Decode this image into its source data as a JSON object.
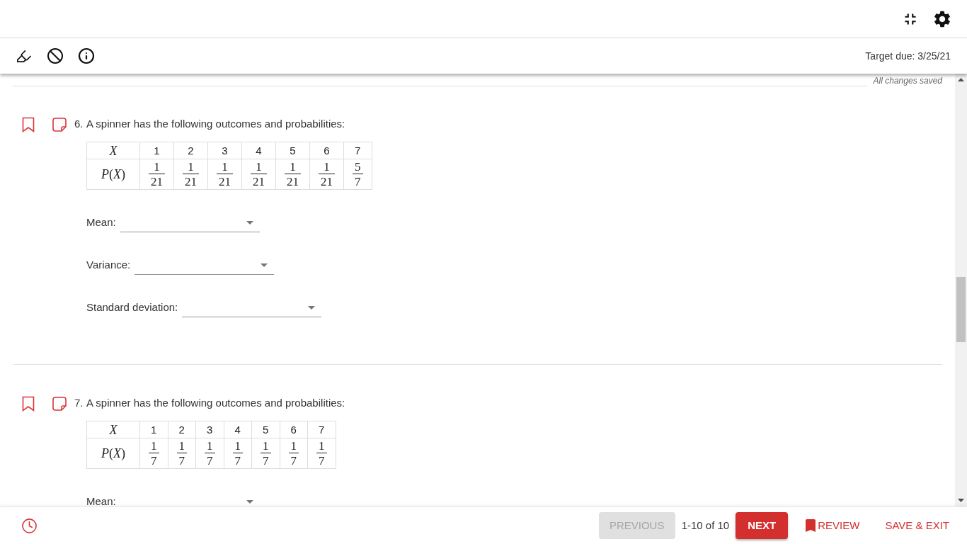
{
  "toolbar": {
    "target_due": "Target due: 3/25/21"
  },
  "save_status": "All changes saved",
  "questions": [
    {
      "number": "6.",
      "prompt": "A spinner has the following outcomes and probabilities:",
      "bookmarked": false,
      "table": {
        "x_label": "X",
        "p_label": "*P*(*X*)",
        "outcomes": [
          "1",
          "2",
          "3",
          "4",
          "5",
          "6",
          "7"
        ],
        "probabilities": [
          {
            "numerator": "1",
            "denominator": "21"
          },
          {
            "numerator": "1",
            "denominator": "21"
          },
          {
            "numerator": "1",
            "denominator": "21"
          },
          {
            "numerator": "1",
            "denominator": "21"
          },
          {
            "numerator": "1",
            "denominator": "21"
          },
          {
            "numerator": "1",
            "denominator": "21"
          },
          {
            "numerator": "5",
            "denominator": "7"
          }
        ]
      },
      "fields": [
        {
          "label": "Mean:"
        },
        {
          "label": "Variance:"
        },
        {
          "label": "Standard deviation:"
        }
      ]
    },
    {
      "number": "7.",
      "prompt": "A spinner has the following outcomes and probabilities:",
      "bookmarked": false,
      "table": {
        "x_label": "X",
        "p_label": "*P*(*X*)",
        "outcomes": [
          "1",
          "2",
          "3",
          "4",
          "5",
          "6",
          "7"
        ],
        "probabilities": [
          {
            "numerator": "1",
            "denominator": "7"
          },
          {
            "numerator": "1",
            "denominator": "7"
          },
          {
            "numerator": "1",
            "denominator": "7"
          },
          {
            "numerator": "1",
            "denominator": "7"
          },
          {
            "numerator": "1",
            "denominator": "7"
          },
          {
            "numerator": "1",
            "denominator": "7"
          },
          {
            "numerator": "1",
            "denominator": "7"
          }
        ]
      },
      "fields": [
        {
          "label": "Mean:"
        }
      ]
    }
  ],
  "footer": {
    "previous": {
      "label": "PREVIOUS",
      "disabled": true
    },
    "page_info": "1-10 of 10",
    "next": {
      "label": "NEXT"
    },
    "review": {
      "label": "REVIEW"
    },
    "save_exit": {
      "label": "SAVE & EXIT"
    }
  }
}
